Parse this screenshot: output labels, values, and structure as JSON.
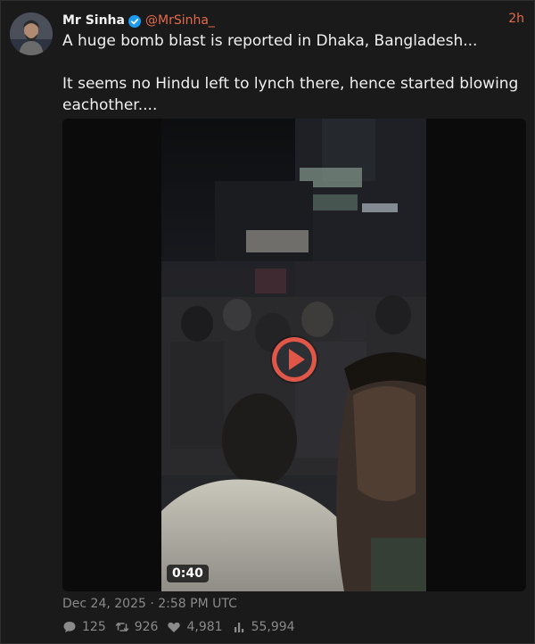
{
  "author": {
    "display_name": "Mr Sinha",
    "handle": "@MrSinha_",
    "verified": true
  },
  "relative_time": "2h",
  "text": {
    "line1": "A huge bomb blast is reported in Dhaka, Bangladesh...",
    "line2": "It seems no Hindu left to lynch there, hence started blowing eachother...."
  },
  "media": {
    "type": "video",
    "duration": "0:40"
  },
  "posted_at": "Dec 24, 2025 · 2:58 PM UTC",
  "stats": {
    "replies": "125",
    "retweets": "926",
    "likes": "4,981",
    "views": "55,994"
  },
  "icons": {
    "verified": "verified-badge-icon",
    "reply": "comment-icon",
    "retweet": "retweet-icon",
    "like": "heart-icon",
    "views": "bar-chart-icon",
    "play": "play-icon"
  },
  "colors": {
    "background": "#1a1a1a",
    "accent": "#e26a4b",
    "verified": "#1d9bf0",
    "muted": "#8a8a8a"
  }
}
